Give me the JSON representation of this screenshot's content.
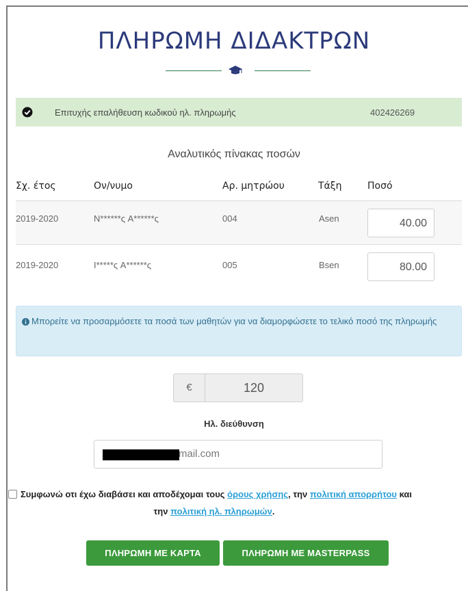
{
  "page": {
    "title": "ΠΛΗΡΩΜΗ ΔΙΔΑΚΤΡΩΝ"
  },
  "success": {
    "message": "Επιτυχής επαλήθευση κωδικού ηλ. πληρωμής",
    "code": "402426269",
    "icon": "check-circle-icon"
  },
  "table": {
    "title": "Αναλυτικός πίνακας ποσών",
    "headers": [
      "Σχ. έτος",
      "Ον/νυμο",
      "Αρ. μητρώου",
      "Τάξη",
      "Ποσό"
    ],
    "rows": [
      {
        "year": "2019-2020",
        "name": "N******ς A******ς",
        "reg": "004",
        "class": "Asen",
        "amount": "40.00"
      },
      {
        "year": "2019-2020",
        "name": "I*****ς A******ς",
        "reg": "005",
        "class": "Bsen",
        "amount": "80.00"
      }
    ]
  },
  "info": {
    "text": "Μπορείτε να προσαρμόσετε τα ποσά των μαθητών για να διαμορφώσετε το τελικό ποσό της πληρωμής"
  },
  "total": {
    "currency": "€",
    "value": "120"
  },
  "email": {
    "label": "Ηλ. διεύθυνση",
    "visible_suffix": "mail.com"
  },
  "terms": {
    "part1": "Συμφωνώ οτι έχω διαβάσει και αποδέχομαι τους ",
    "link_terms": "όρους χρήσης",
    "part2": ", την ",
    "link_privacy": "πολιτική απορρήτου",
    "part3": " και",
    "part4": "την ",
    "link_payments": "πολιτική ηλ. πληρωμών",
    "part5": "."
  },
  "buttons": {
    "pay_card": "ΠΛΗΡΩΜΗ ΜΕ ΚΑΡΤΑ",
    "pay_masterpass": "ΠΛΗΡΩΜΗ ΜΕ MASTERPASS"
  },
  "colors": {
    "title": "#2b3a7a",
    "accent_green": "#3c9a3c",
    "success_bg": "#d8ecd2",
    "info_bg": "#d9edf7",
    "link": "#2a9fd6"
  }
}
